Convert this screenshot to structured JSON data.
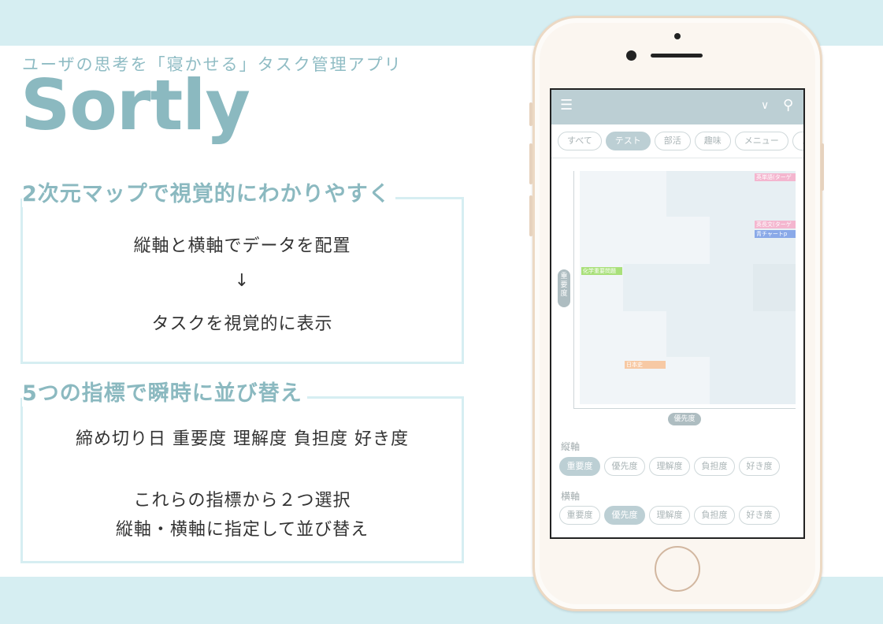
{
  "tagline": "ユーザの思考を「寝かせる」タスク管理アプリ",
  "app_name": "Sortly",
  "section1": {
    "heading": "2次元マップで視覚的にわかりやすく",
    "line1": "縦軸と横軸でデータを配置",
    "arrow": "↓",
    "line2": "タスクを視覚的に表示"
  },
  "section2": {
    "heading": "5つの指標で瞬時に並び替え",
    "line1": "締め切り日 重要度 理解度 負担度 好き度",
    "line2": "これらの指標から２つ選択",
    "line3": "縦軸・横軸に指定して並び替え"
  },
  "phone_app": {
    "icons": {
      "menu": "menu-icon",
      "collapse": "double-chevron-down-icon",
      "search": "search-icon"
    },
    "tabs": [
      "すべて",
      "テスト",
      "部活",
      "趣味",
      "メニュー",
      "メ"
    ],
    "active_tab": "テスト",
    "y_axis_label": "重要度",
    "x_axis_label": "優先度",
    "tasks": [
      {
        "label": "英単語(ターゲ",
        "color": "#f4b6cf"
      },
      {
        "label": "英長文(ターゲ",
        "color": "#f4b6cf"
      },
      {
        "label": "青チャートp",
        "color": "#8aa9e8"
      },
      {
        "label": "化学重要問題",
        "color": "#a9e07a"
      },
      {
        "label": "日本史",
        "color": "#f7c9a4"
      }
    ],
    "vertical_axis": {
      "label": "縦軸",
      "options": [
        "重要度",
        "優先度",
        "理解度",
        "負担度",
        "好き度"
      ],
      "selected": "重要度"
    },
    "horizontal_axis": {
      "label": "横軸",
      "options": [
        "重要度",
        "優先度",
        "理解度",
        "負担度",
        "好き度"
      ],
      "selected": "優先度"
    }
  },
  "colors": {
    "accent": "#8bb9c0",
    "band": "#d6eef2",
    "app_bar": "#bccfd4"
  }
}
